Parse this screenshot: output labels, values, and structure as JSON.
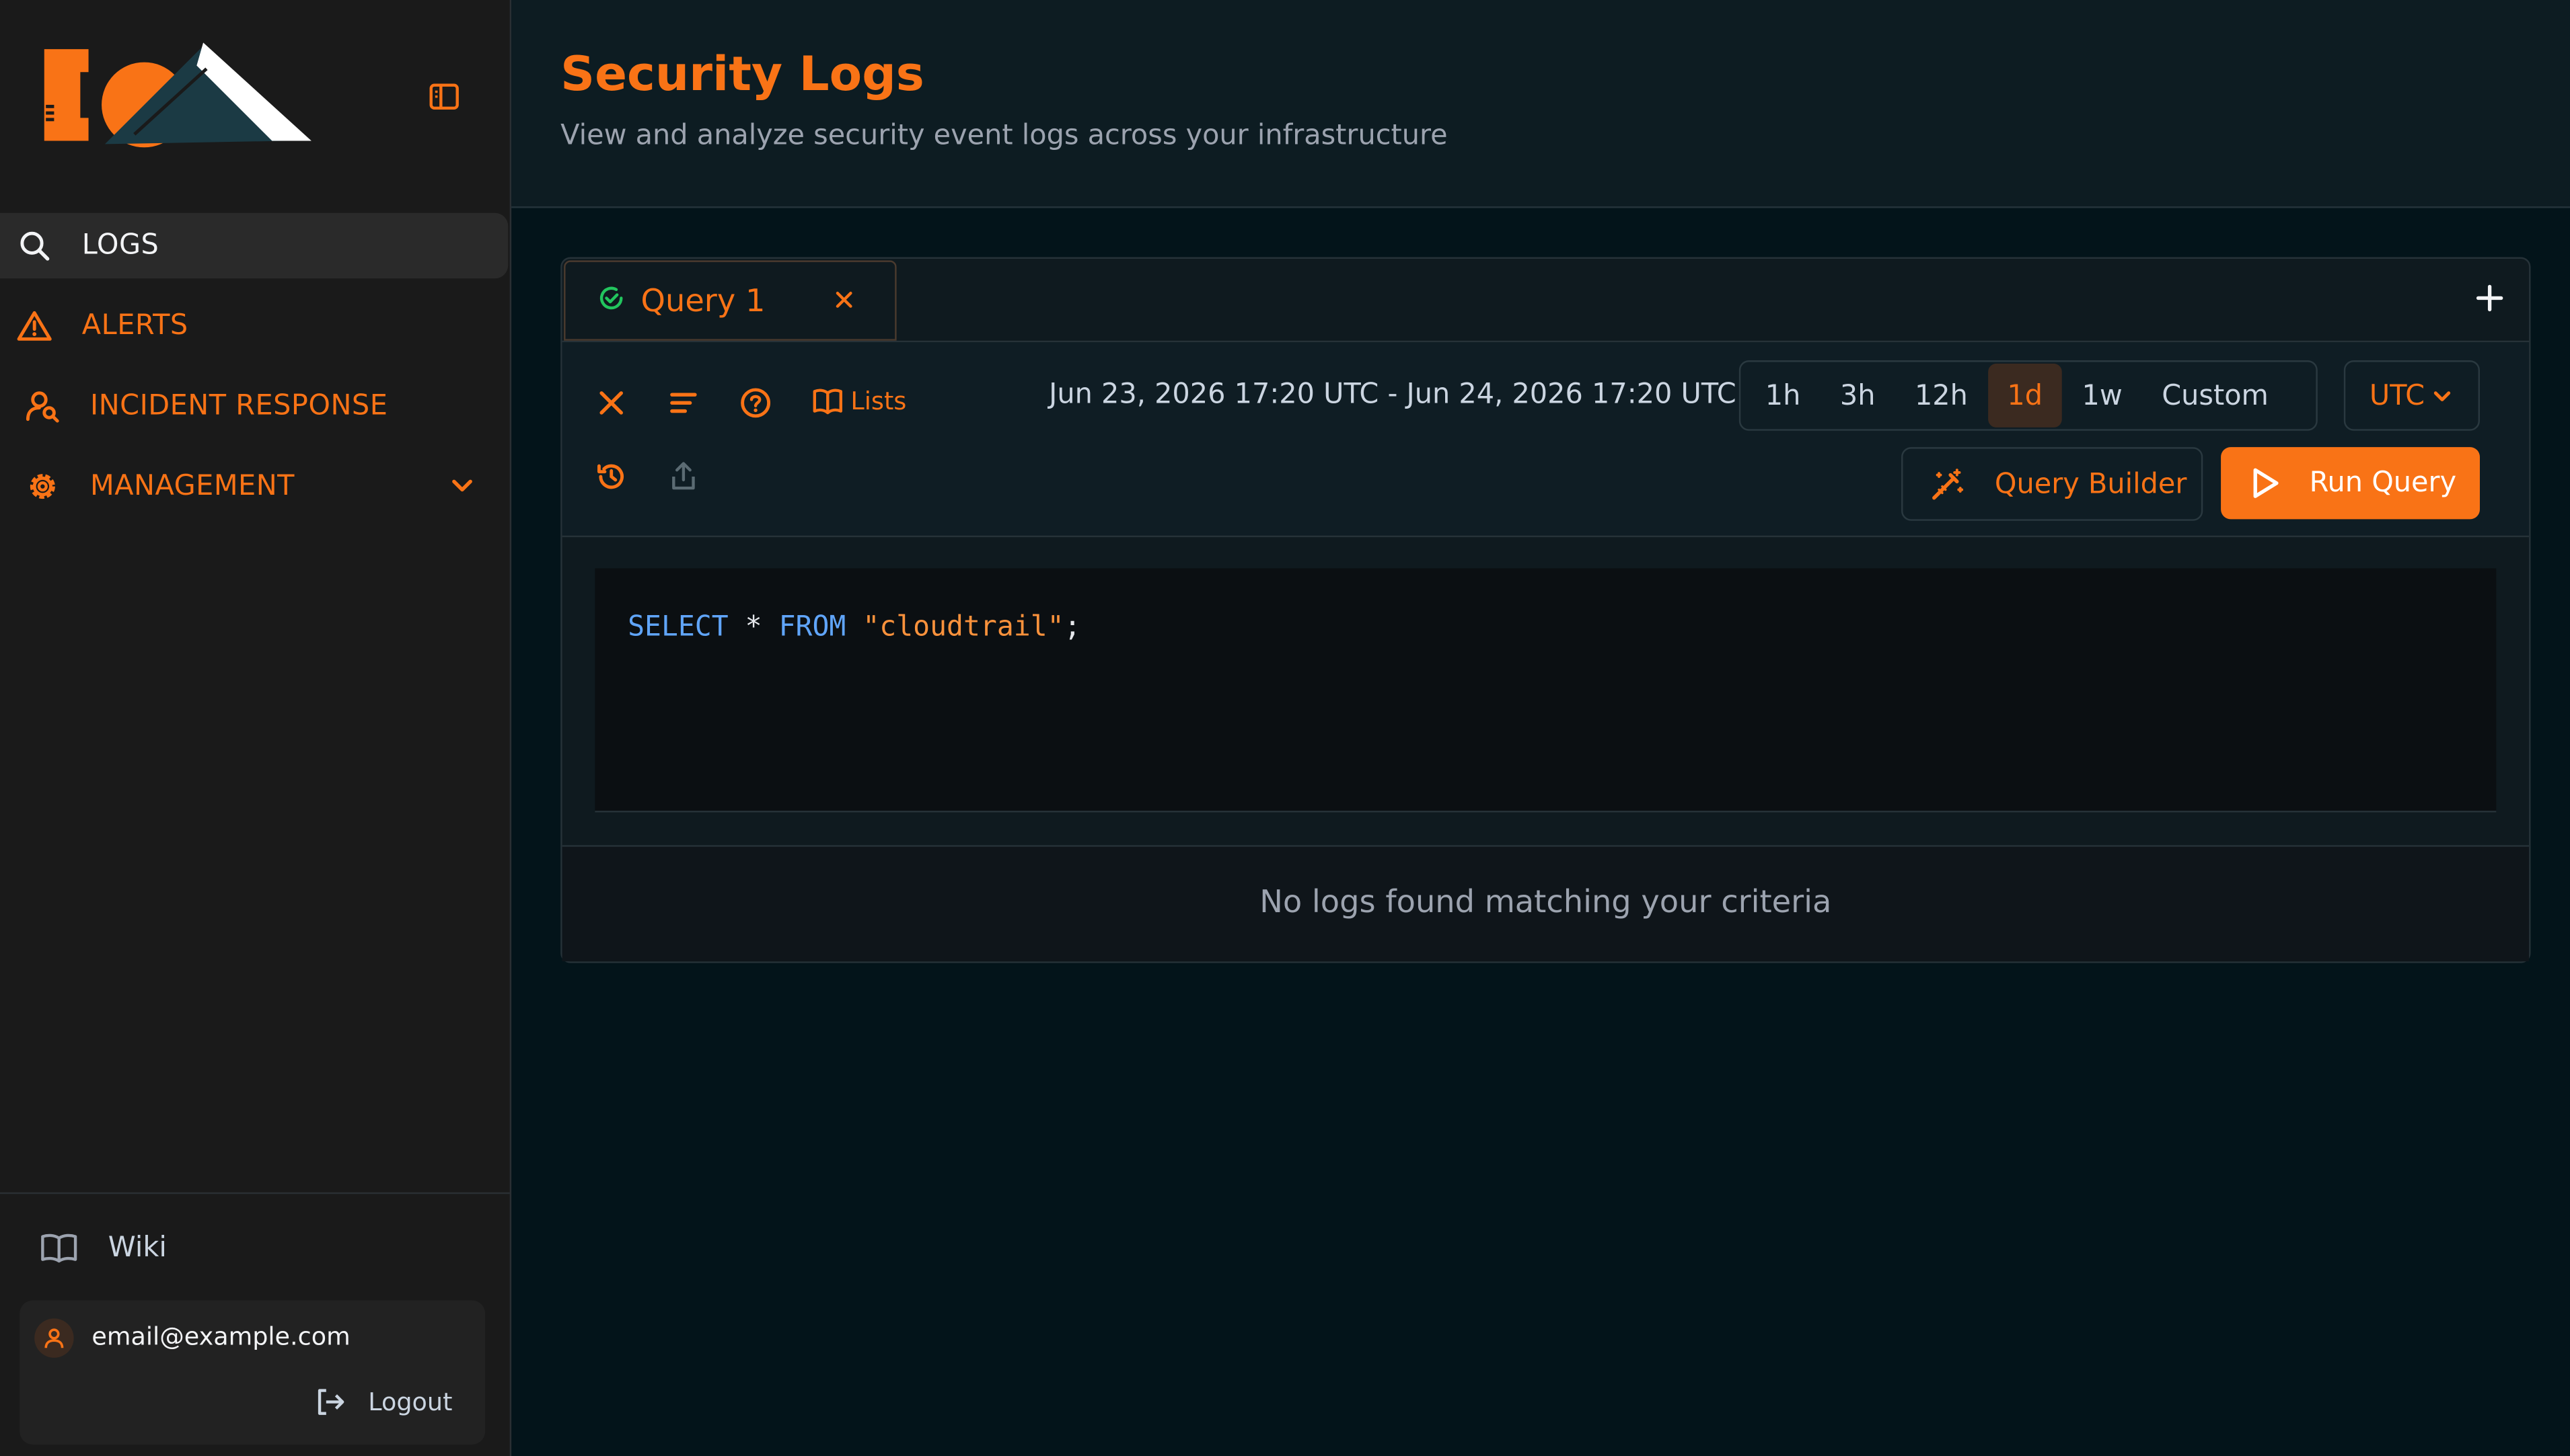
{
  "sidebar": {
    "nav": [
      {
        "label": "LOGS",
        "icon": "search-icon",
        "active": true
      },
      {
        "label": "ALERTS",
        "icon": "alert-triangle-icon"
      },
      {
        "label": "INCIDENT RESPONSE",
        "icon": "user-search-icon"
      },
      {
        "label": "MANAGEMENT",
        "icon": "gear-icon",
        "expandable": true
      }
    ],
    "wiki_label": "Wiki",
    "user_email": "email@example.com",
    "logout_label": "Logout"
  },
  "header": {
    "title": "Security Logs",
    "subtitle": "View and analyze security event logs across your infrastructure"
  },
  "query": {
    "tabs": [
      {
        "label": "Query 1",
        "status": "success"
      }
    ],
    "lists_label": "Lists",
    "date_range": "Jun 23, 2026 17:20 UTC - Jun 24, 2026 17:20 UTC",
    "ranges": [
      "1h",
      "3h",
      "12h",
      "1d",
      "1w",
      "Custom"
    ],
    "selected_range": "1d",
    "timezone": "UTC",
    "query_builder_label": "Query Builder",
    "run_label": "Run Query",
    "code": {
      "kw_select": "SELECT",
      "star": "*",
      "kw_from": "FROM",
      "table": "\"cloudtrail\"",
      "semicolon": ";"
    },
    "empty_message": "No logs found matching your criteria"
  },
  "colors": {
    "accent": "#f97316",
    "background": "#03141a",
    "sidebar": "#1a1a1a",
    "keyword": "#60a5fa",
    "string": "#fb923c",
    "success": "#22c55e"
  }
}
